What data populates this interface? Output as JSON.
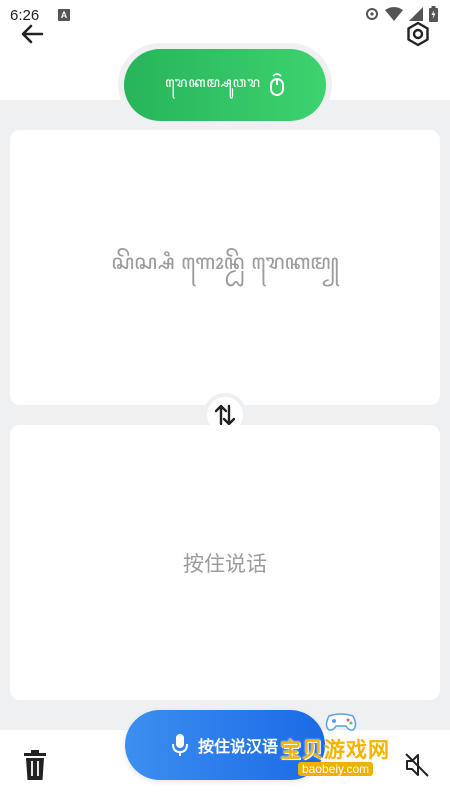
{
  "status_bar": {
    "time": "6:26",
    "notification_letter": "A"
  },
  "header": {
    "mode_label": "ꦫꦺꦏꦩ꧀ꦱꦸꦮꦫ"
  },
  "source_card": {
    "prompt": "ꦱꦼꦱ꧀ꦱꦶ ꦒꦺꦴꦤ꧀ꦝꦼ ꦫꦺꦏꦩ꧀"
  },
  "target_card": {
    "prompt": "按住说话"
  },
  "talk_button": {
    "label": "按住说汉语"
  },
  "watermark": {
    "text": "宝贝游戏网",
    "url": "baobeiy.com"
  },
  "colors": {
    "green_accent": "#2fc463",
    "blue_accent": "#2478ea",
    "background": "#eef0f2"
  }
}
